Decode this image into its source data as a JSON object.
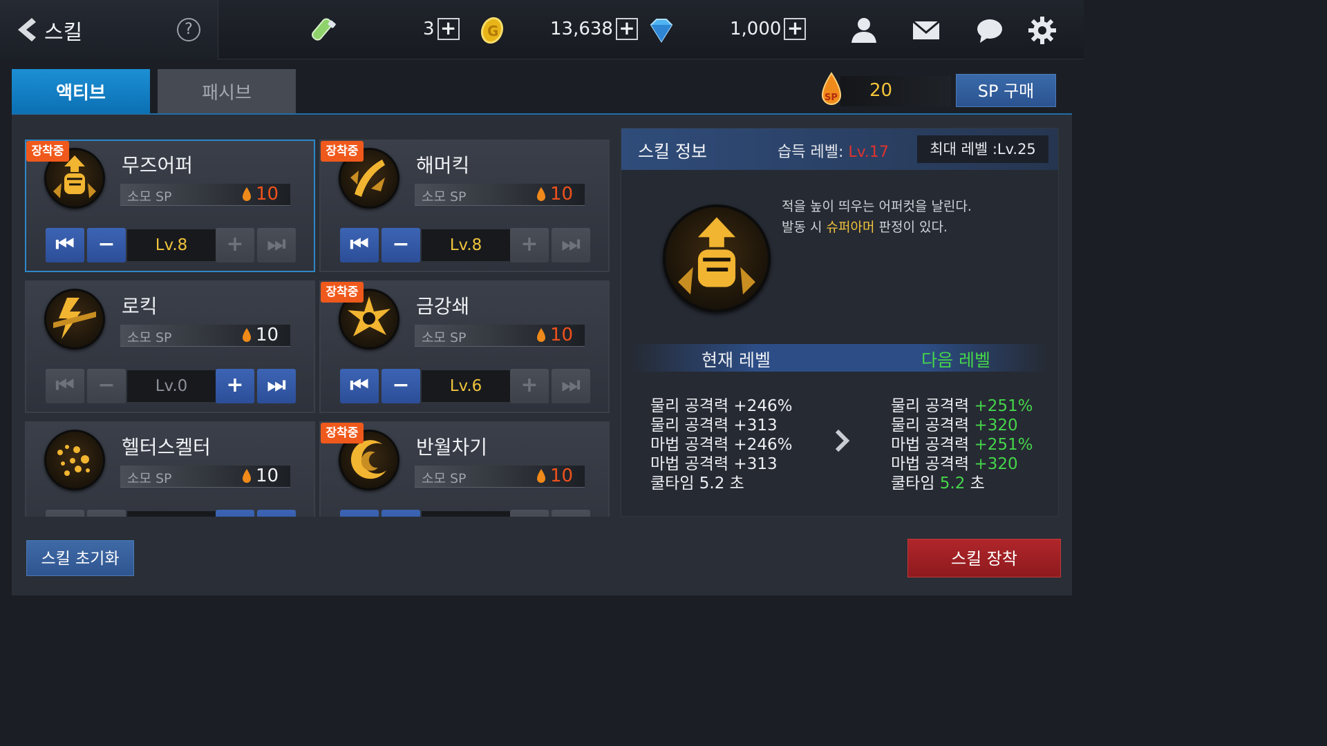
{
  "header": {
    "title": "스킬",
    "help_label": "?",
    "resources": [
      {
        "icon": "stamina-potion-icon",
        "value": "3"
      },
      {
        "icon": "gold-coin-icon",
        "value": "13,638"
      },
      {
        "icon": "diamond-icon",
        "value": "1,000"
      }
    ],
    "plus_label": "+"
  },
  "tabs": [
    {
      "label": "액티브",
      "active": true
    },
    {
      "label": "패시브",
      "active": false
    }
  ],
  "sp": {
    "badge": "SP",
    "value": "20",
    "buy_label": "SP 구매"
  },
  "skill_cards": [
    {
      "name": "무즈어퍼",
      "equipped": true,
      "badge": "장착중",
      "sp_label": "소모 SP",
      "sp_cost": "10",
      "level": "Lv.8",
      "selected": true
    },
    {
      "name": "해머킥",
      "equipped": true,
      "badge": "장착중",
      "sp_label": "소모 SP",
      "sp_cost": "10",
      "level": "Lv.8",
      "selected": false
    },
    {
      "name": "로킥",
      "equipped": false,
      "badge": "",
      "sp_label": "소모 SP",
      "sp_cost": "10",
      "level": "Lv.0",
      "selected": false
    },
    {
      "name": "금강쇄",
      "equipped": true,
      "badge": "장착중",
      "sp_label": "소모 SP",
      "sp_cost": "10",
      "level": "Lv.6",
      "selected": false
    },
    {
      "name": "헬터스켈터",
      "equipped": false,
      "badge": "",
      "sp_label": "소모 SP",
      "sp_cost": "10",
      "level": "",
      "selected": false
    },
    {
      "name": "반월차기",
      "equipped": true,
      "badge": "장착중",
      "sp_label": "소모 SP",
      "sp_cost": "10",
      "level": "",
      "selected": false
    }
  ],
  "controls": {
    "first": "⏮",
    "minus": "−",
    "plus": "+",
    "last": "⏭"
  },
  "info": {
    "title": "스킬 정보",
    "learn_label": "습득 레벨: ",
    "learn_value": "Lv.17",
    "max_level": "최대 레벨 :Lv.25",
    "desc_line1": "적을 높이 띄우는 어퍼컷을 날린다.",
    "desc_line2_pre": "발동 시 ",
    "desc_line2_hl": "슈퍼아머",
    "desc_line2_post": " 판정이 있다.",
    "current_label": "현재 레벨",
    "next_label": "다음 레벨",
    "current_stats": [
      "물리 공격력  +246%",
      "물리 공격력  +313",
      "마법 공격력  +246%",
      "마법 공격력  +313",
      "쿨타임 5.2 초"
    ],
    "next_stats": [
      {
        "label": "물리 공격력  ",
        "value": "+251%",
        "suffix": ""
      },
      {
        "label": "물리 공격력  ",
        "value": "+320",
        "suffix": ""
      },
      {
        "label": "마법 공격력  ",
        "value": "+251%",
        "suffix": ""
      },
      {
        "label": "마법 공격력  ",
        "value": "+320",
        "suffix": ""
      },
      {
        "label": "쿨타임 ",
        "value": "5.2",
        "suffix": " 초"
      }
    ]
  },
  "footer": {
    "reset_label": "스킬 초기화",
    "equip_label": "스킬 장착"
  },
  "colors": {
    "accent_blue": "#1d8fd4",
    "equip_badge": "#f0591c",
    "gold": "#f0c43c",
    "red_cost": "#f0521c",
    "green": "#45d64a",
    "equip_button": "#b0262a"
  }
}
